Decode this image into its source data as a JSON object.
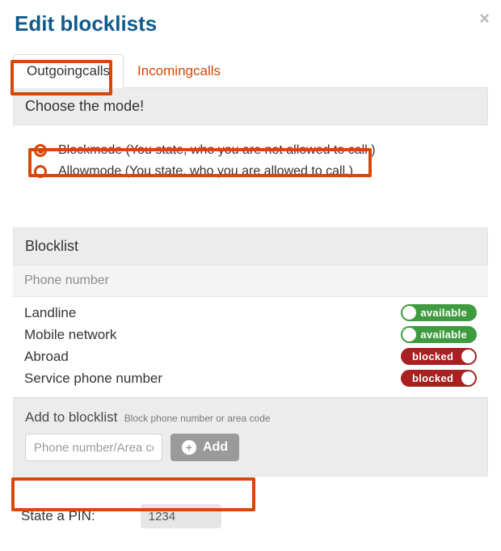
{
  "title": "Edit blocklists",
  "tabs": {
    "outgoing": "Outgoingcalls",
    "incoming": "Incomingcalls"
  },
  "mode": {
    "header": "Choose the mode!",
    "block": "Blockmode (You state, who you are not allowed to call.)",
    "allow": "Allowmode (You state, who you are allowed to call.)"
  },
  "blocklist": {
    "header": "Blocklist",
    "column": "Phone number",
    "rows": [
      {
        "label": "Landline",
        "status": "available"
      },
      {
        "label": "Mobile network",
        "status": "available"
      },
      {
        "label": "Abroad",
        "status": "blocked"
      },
      {
        "label": "Service phone number",
        "status": "blocked"
      }
    ],
    "status_text": {
      "available": "available",
      "blocked": "blocked"
    }
  },
  "add": {
    "label": "Add to blocklist",
    "hint": "Block phone number or area code",
    "placeholder": "Phone number/Area code",
    "button": "Add"
  },
  "pin": {
    "label": "State a PIN:",
    "value": "1234"
  }
}
